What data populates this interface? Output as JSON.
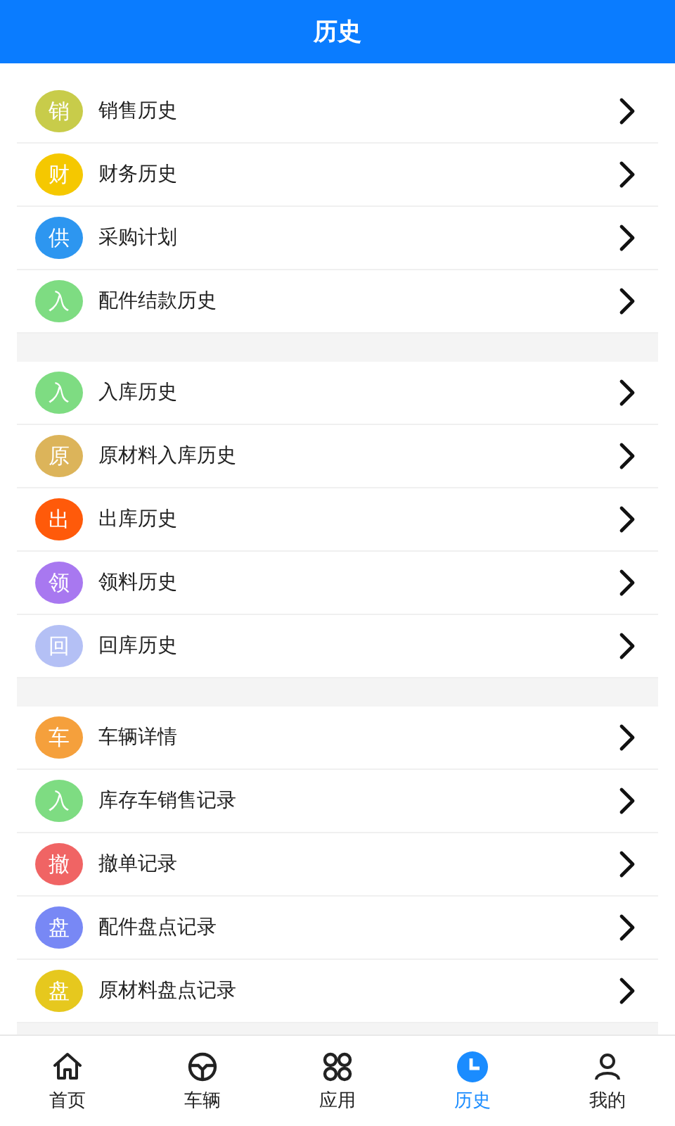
{
  "header": {
    "title": "历史"
  },
  "sections": [
    {
      "items": [
        {
          "badge": "销",
          "label": "销售历史",
          "color": "#c8cc4a"
        },
        {
          "badge": "财",
          "label": "财务历史",
          "color": "#f5c800"
        },
        {
          "badge": "供",
          "label": "采购计划",
          "color": "#2d96f0"
        },
        {
          "badge": "入",
          "label": "配件结款历史",
          "color": "#7edc82"
        }
      ]
    },
    {
      "items": [
        {
          "badge": "入",
          "label": "入库历史",
          "color": "#7edc82"
        },
        {
          "badge": "原",
          "label": "原材料入库历史",
          "color": "#dcb45a"
        },
        {
          "badge": "出",
          "label": "出库历史",
          "color": "#ff5a0a"
        },
        {
          "badge": "领",
          "label": "领料历史",
          "color": "#a878f0"
        },
        {
          "badge": "回",
          "label": "回库历史",
          "color": "#b4c0f5"
        }
      ]
    },
    {
      "items": [
        {
          "badge": "车",
          "label": "车辆详情",
          "color": "#f5a03c"
        },
        {
          "badge": "入",
          "label": "库存车销售记录",
          "color": "#7edc82"
        },
        {
          "badge": "撤",
          "label": "撤单记录",
          "color": "#f06464"
        },
        {
          "badge": "盘",
          "label": "配件盘点记录",
          "color": "#7888f5"
        },
        {
          "badge": "盘",
          "label": "原材料盘点记录",
          "color": "#e6c81e"
        }
      ]
    }
  ],
  "tab_bar": [
    {
      "kind": "home",
      "label": "首页",
      "selected": false
    },
    {
      "kind": "wheel",
      "label": "车辆",
      "selected": false
    },
    {
      "kind": "apps",
      "label": "应用",
      "selected": false
    },
    {
      "kind": "clock",
      "label": "历史",
      "selected": true
    },
    {
      "kind": "user",
      "label": "我的",
      "selected": false
    }
  ]
}
